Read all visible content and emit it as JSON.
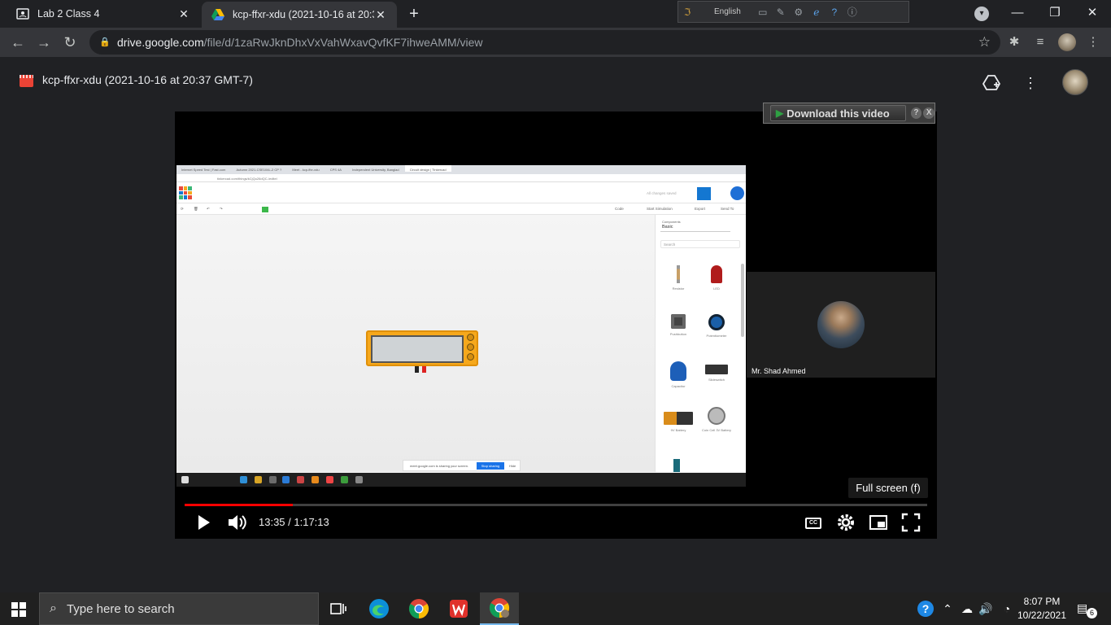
{
  "browser": {
    "tabs": [
      {
        "title": "Lab 2 Class 4",
        "icon": "classroom-icon"
      },
      {
        "title": "kcp-ffxr-xdu (2021-10-16 at 20:3",
        "icon": "google-drive-icon"
      }
    ],
    "url_host": "drive.google.com",
    "url_path": "/file/d/1zaRwJknDhxVxVahWxavQvfKF7ihweAMM/view",
    "language_bar": {
      "language": "English"
    }
  },
  "viewer": {
    "file_title": "kcp-ffxr-xdu (2021-10-16 at 20:37 GMT-7)"
  },
  "video": {
    "download_label": "Download this video",
    "download_help": "?",
    "download_close": "X",
    "participant_name": "Mr. Shad Ahmed",
    "fullscreen_tooltip": "Full screen (f)",
    "current_time": "13:35",
    "duration": "1:17:13",
    "time_display": "13:35 / 1:17:13",
    "progress_fraction": 0.146,
    "cc_label": "CC"
  },
  "shared_screen": {
    "tabs": [
      "Internet Speed Test | Fast.com",
      "Autumn 2021-CSE104L-2 CP ?",
      "Meet - kcp-ffxr-xdu",
      "CPS 4A",
      "Independent University, Banglad",
      "Circuit design | Tinkercad"
    ],
    "url": "tinkercad.com/things/kCjQu26dQC-/editel",
    "saved_status": "All changes saved",
    "toolbar_items": [
      "Code",
      "Start Simulation",
      "Export",
      "Send To"
    ],
    "components_label": "Components",
    "components_category": "Basic",
    "search_placeholder": "Search",
    "components": [
      "Resistor",
      "LED",
      "Pushbutton",
      "Potentiometer",
      "Capacitor",
      "Slideswitch",
      "9V Battery",
      "Coin Cell 3V Battery"
    ],
    "share_notice": "meet.google.com is sharing your screen.",
    "stop_sharing": "Stop sharing",
    "hide": "Hide"
  },
  "taskbar": {
    "search_placeholder": "Type here to search",
    "time": "8:07 PM",
    "date": "10/22/2021",
    "notification_count": "6"
  },
  "colors": {
    "progress_red": "#ff0000",
    "drive_accent": "#ea4335",
    "tinkercad_blue": "#1477d1",
    "multimeter_orange": "#f6a81c"
  }
}
